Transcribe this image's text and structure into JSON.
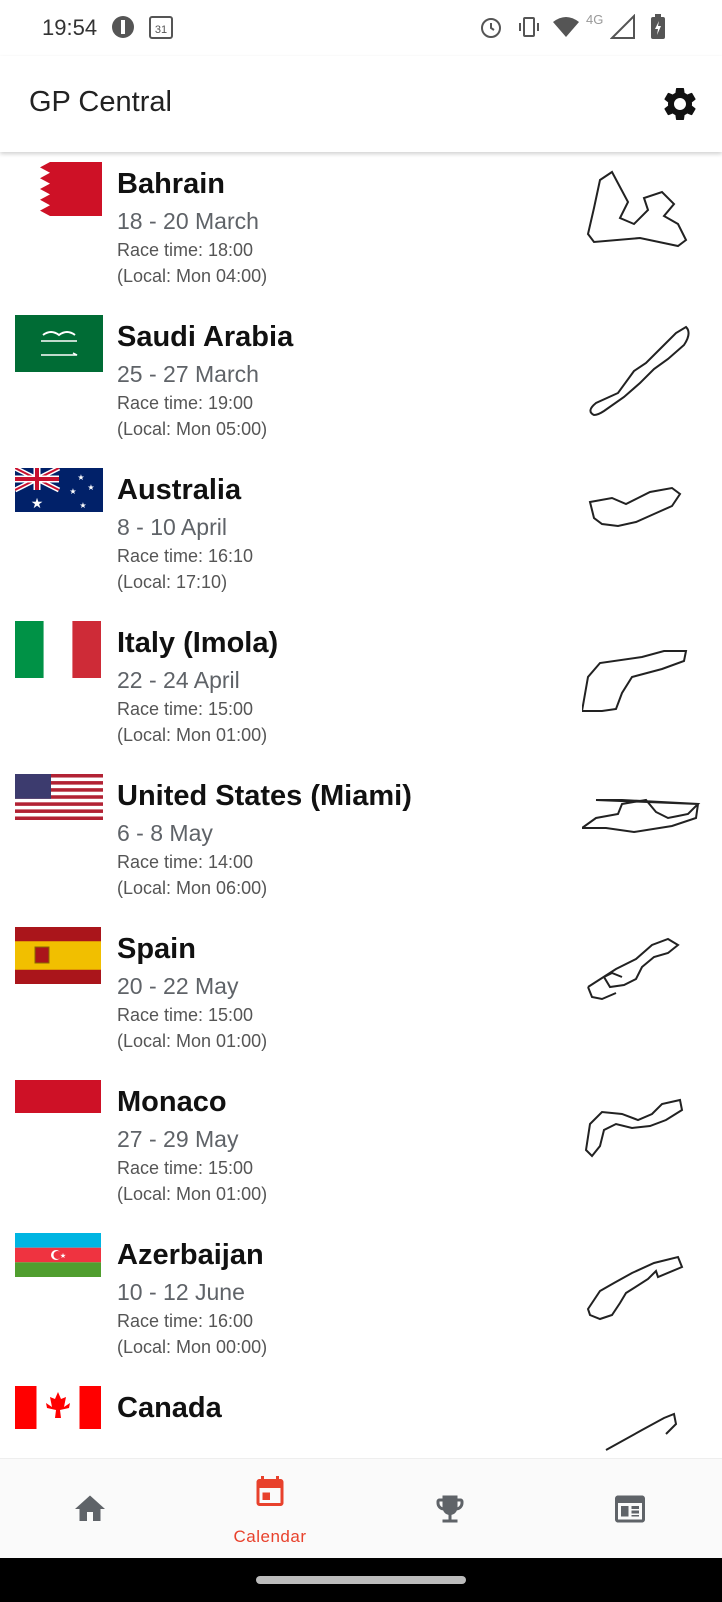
{
  "status_bar": {
    "time": "19:54",
    "network": "4G",
    "calendar_day": "31"
  },
  "app_bar": {
    "title": "GP Central"
  },
  "races": [
    {
      "name": "Bahrain",
      "dates": "18 - 20 March",
      "race_time": "Race time: 18:00",
      "local": "(Local: Mon 04:00)"
    },
    {
      "name": "Saudi Arabia",
      "dates": "25 - 27 March",
      "race_time": "Race time: 19:00",
      "local": "(Local: Mon 05:00)"
    },
    {
      "name": "Australia",
      "dates": "8 - 10 April",
      "race_time": "Race time: 16:10",
      "local": "(Local: 17:10)"
    },
    {
      "name": "Italy (Imola)",
      "dates": "22 - 24 April",
      "race_time": "Race time: 15:00",
      "local": "(Local: Mon 01:00)"
    },
    {
      "name": "United States (Miami)",
      "dates": "6 - 8 May",
      "race_time": "Race time: 14:00",
      "local": "(Local: Mon 06:00)"
    },
    {
      "name": "Spain",
      "dates": "20 - 22 May",
      "race_time": "Race time: 15:00",
      "local": "(Local: Mon 01:00)"
    },
    {
      "name": "Monaco",
      "dates": "27 - 29 May",
      "race_time": "Race time: 15:00",
      "local": "(Local: Mon 01:00)"
    },
    {
      "name": "Azerbaijan",
      "dates": "10 - 12 June",
      "race_time": "Race time: 16:00",
      "local": "(Local: Mon 00:00)"
    },
    {
      "name": "Canada",
      "dates": "",
      "race_time": "",
      "local": ""
    }
  ],
  "bottom_nav": {
    "items": [
      {
        "icon": "home-icon",
        "label": "",
        "active": false
      },
      {
        "icon": "calendar-icon",
        "label": "Calendar",
        "active": true
      },
      {
        "icon": "trophy-icon",
        "label": "",
        "active": false
      },
      {
        "icon": "news-icon",
        "label": "",
        "active": false
      }
    ]
  },
  "colors": {
    "accent": "#e8412c",
    "icon_gray": "#5f6368"
  }
}
